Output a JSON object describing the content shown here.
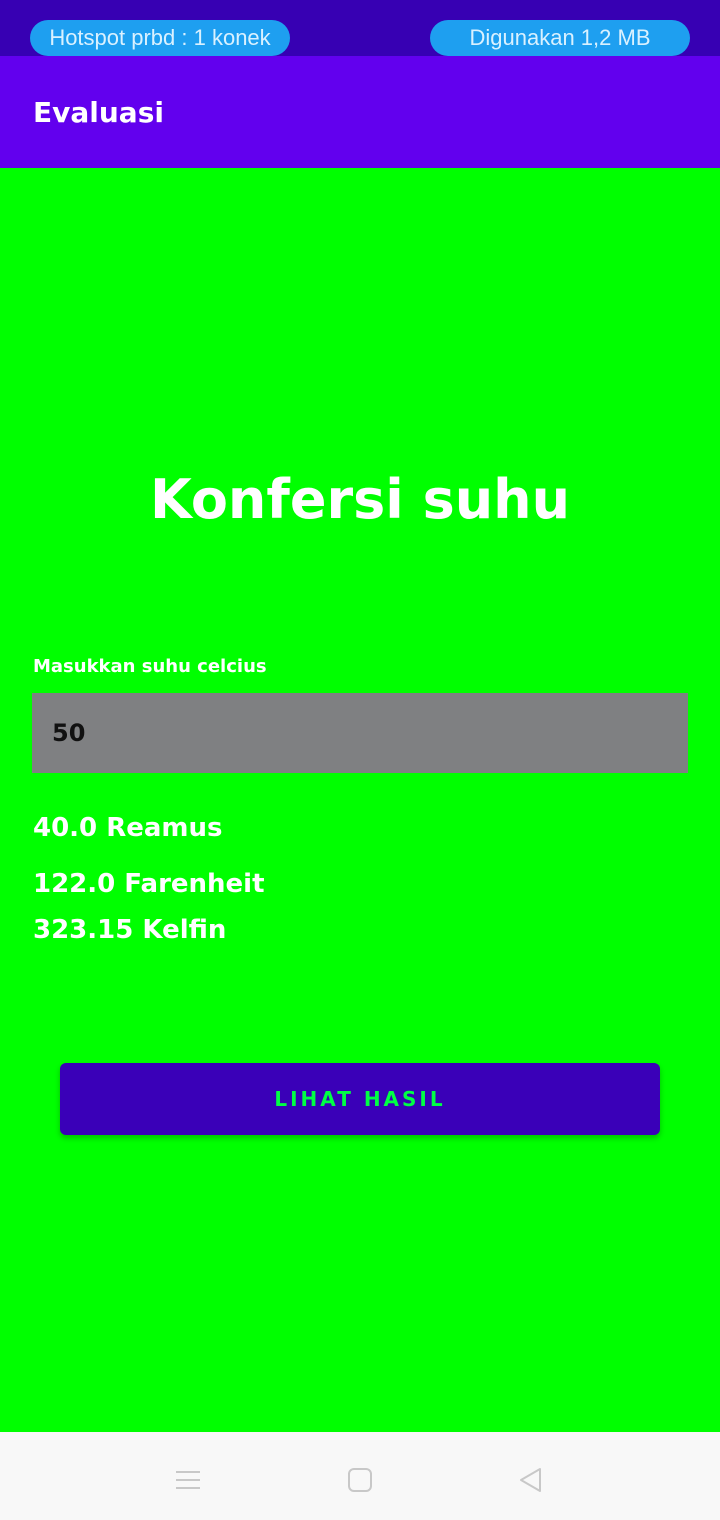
{
  "status_bar": {
    "hotspot_text": "Hotspot prbd : 1 konek",
    "usage_text": "Digunakan 1,2 MB"
  },
  "app_bar": {
    "title": "Evaluasi"
  },
  "main": {
    "heading": "Konfersi suhu",
    "input_label": "Masukkan suhu celcius",
    "input_value": "50",
    "results": {
      "reamur": "40.0 Reamus",
      "fahrenheit": "122.0 Farenheit",
      "kelvin": "323.15 Kelfin"
    },
    "button_label": "LIHAT HASIL"
  },
  "nav_bar": {
    "icons": [
      "menu-icon",
      "home-square-icon",
      "back-triangle-icon"
    ]
  },
  "colors": {
    "status_bar": "#3700b3",
    "app_bar": "#6200ee",
    "background": "#00ff00",
    "input_bg": "#7f8082",
    "button_bg": "#3a00b8",
    "button_text": "#00ff44",
    "pill": "#1e9ff0"
  }
}
